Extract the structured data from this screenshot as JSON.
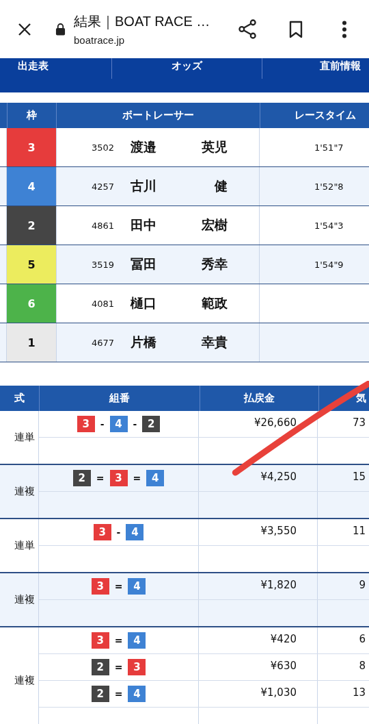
{
  "browser": {
    "title": "結果｜BOAT RACE …",
    "url": "boatrace.jp"
  },
  "nav": [
    "出走表",
    "オッズ",
    "直前情報"
  ],
  "results": {
    "columns": [
      "枠",
      "ボートレーサー",
      "レースタイム"
    ],
    "rows": [
      {
        "frame": "3",
        "color": "#e63c3c",
        "number": "3502",
        "surname": "渡邉",
        "given": "英児",
        "time": "1'51\"7"
      },
      {
        "frame": "4",
        "color": "#3e82d4",
        "number": "4257",
        "surname": "古川",
        "given": "健",
        "time": "1'52\"8"
      },
      {
        "frame": "2",
        "color": "#454545",
        "number": "4861",
        "surname": "田中",
        "given": "宏樹",
        "time": "1'54\"3"
      },
      {
        "frame": "5",
        "color": "#ecec5e",
        "number": "3519",
        "surname": "冨田",
        "given": "秀幸",
        "time": "1'54\"9"
      },
      {
        "frame": "6",
        "color": "#4db34a",
        "number": "4081",
        "surname": "樋口",
        "given": "範政"
      },
      {
        "frame": "1",
        "color": "#e9e9e9",
        "number": "4677",
        "surname": "片橋",
        "given": "幸貴"
      }
    ]
  },
  "payouts": {
    "columns": [
      "式",
      "組番",
      "払戻金",
      "気"
    ],
    "groups": [
      {
        "type": "連単",
        "rows": [
          {
            "boats": [
              {
                "n": "3",
                "color": "#e63c3c"
              },
              {
                "n": "4",
                "color": "#3e82d4"
              },
              {
                "n": "2",
                "color": "#454545"
              }
            ],
            "joiner": "-",
            "amount": "¥26,660",
            "popularity": "73"
          }
        ]
      },
      {
        "type": "連複",
        "rows": [
          {
            "boats": [
              {
                "n": "2",
                "color": "#454545"
              },
              {
                "n": "3",
                "color": "#e63c3c"
              },
              {
                "n": "4",
                "color": "#3e82d4"
              }
            ],
            "joiner": "=",
            "amount": "¥4,250",
            "popularity": "15"
          }
        ]
      },
      {
        "type": "連単",
        "rows": [
          {
            "boats": [
              {
                "n": "3",
                "color": "#e63c3c"
              },
              {
                "n": "4",
                "color": "#3e82d4"
              }
            ],
            "joiner": "-",
            "amount": "¥3,550",
            "popularity": "11"
          }
        ]
      },
      {
        "type": "連複",
        "rows": [
          {
            "boats": [
              {
                "n": "3",
                "color": "#e63c3c"
              },
              {
                "n": "4",
                "color": "#3e82d4"
              }
            ],
            "joiner": "=",
            "amount": "¥1,820",
            "popularity": "9"
          }
        ]
      },
      {
        "type": "連複",
        "rows": [
          {
            "boats": [
              {
                "n": "3",
                "color": "#e63c3c"
              },
              {
                "n": "4",
                "color": "#3e82d4"
              }
            ],
            "joiner": "=",
            "amount": "¥420",
            "popularity": "6"
          },
          {
            "boats": [
              {
                "n": "2",
                "color": "#454545"
              },
              {
                "n": "3",
                "color": "#e63c3c"
              }
            ],
            "joiner": "=",
            "amount": "¥630",
            "popularity": "8"
          },
          {
            "boats": [
              {
                "n": "2",
                "color": "#454545"
              },
              {
                "n": "4",
                "color": "#3e82d4"
              }
            ],
            "joiner": "=",
            "amount": "¥1,030",
            "popularity": "13"
          }
        ]
      }
    ]
  }
}
